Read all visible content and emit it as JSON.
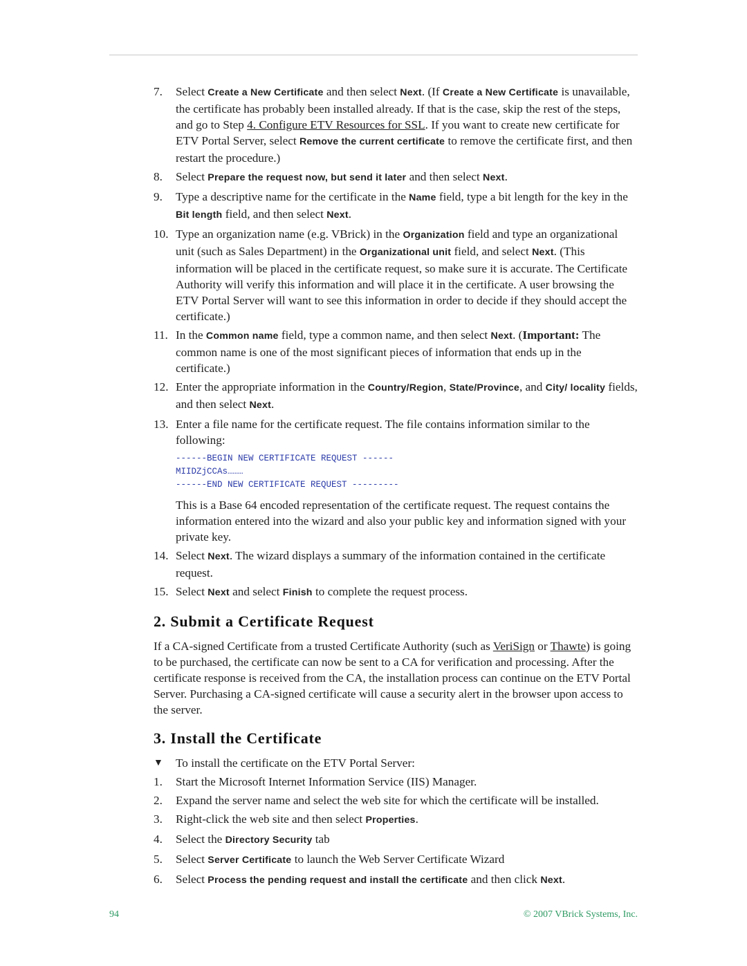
{
  "steps_a": [
    {
      "num": "7.",
      "parts": [
        {
          "t": "Select "
        },
        {
          "b": "Create a New Certificate"
        },
        {
          "t": " and then select "
        },
        {
          "b": "Next"
        },
        {
          "t": ". (If "
        },
        {
          "b": "Create a New Certificate"
        },
        {
          "t": " is unavailable, the certificate has probably been installed already. If that is the case, skip the rest of the steps, and go to Step "
        },
        {
          "link": "4. Configure ETV Resources for SSL"
        },
        {
          "t": ". If you want to create new certificate for ETV Portal Server, select "
        },
        {
          "b": "Remove the current certificate"
        },
        {
          "t": " to remove the certificate first, and then restart the procedure.)"
        }
      ]
    },
    {
      "num": "8.",
      "parts": [
        {
          "t": "Select "
        },
        {
          "b": "Prepare the request now, but send it later"
        },
        {
          "t": " and then select "
        },
        {
          "b": "Next"
        },
        {
          "t": "."
        }
      ]
    },
    {
      "num": "9.",
      "parts": [
        {
          "t": "Type a descriptive name for the certificate in the "
        },
        {
          "b": "Name"
        },
        {
          "t": " field, type a bit length for the key in the "
        },
        {
          "b": "Bit length"
        },
        {
          "t": " field, and then select "
        },
        {
          "b": "Next"
        },
        {
          "t": "."
        }
      ]
    },
    {
      "num": "10.",
      "parts": [
        {
          "t": "Type an organization name (e.g. VBrick) in the "
        },
        {
          "b": "Organization"
        },
        {
          "t": " field and type an organizational unit (such as Sales Department) in the "
        },
        {
          "b": "Organizational unit"
        },
        {
          "t": " field, and select "
        },
        {
          "b": "Next"
        },
        {
          "t": ". (This information will be placed in the certificate request, so make sure it is accurate. The Certificate Authority will verify this information and will place it in the certificate. A user browsing the ETV Portal Server will want to see this information in order to decide if they should accept the certificate.)"
        }
      ]
    },
    {
      "num": "11.",
      "parts": [
        {
          "t": "In the "
        },
        {
          "b": "Common name"
        },
        {
          "t": " field, type a common name, and then select "
        },
        {
          "b": "Next"
        },
        {
          "t": ". ("
        },
        {
          "sb": "Important:"
        },
        {
          "t": " The common name is one of the most significant pieces of information that ends up in the certificate.)"
        }
      ]
    },
    {
      "num": "12.",
      "parts": [
        {
          "t": "Enter the appropriate information in the "
        },
        {
          "b": "Country/Region"
        },
        {
          "t": ", "
        },
        {
          "b": "State/Province"
        },
        {
          "t": ", and "
        },
        {
          "b": "City/ locality"
        },
        {
          "t": " fields, and then select "
        },
        {
          "b": "Next"
        },
        {
          "t": "."
        }
      ]
    },
    {
      "num": "13.",
      "parts": [
        {
          "t": "Enter a file name for the certificate request. The file contains information similar to the following:"
        }
      ]
    }
  ],
  "code_lines": [
    "------BEGIN NEW CERTIFICATE REQUEST ------",
    "MIIDZjCCAs………",
    "------END NEW CERTIFICATE REQUEST ---------"
  ],
  "after_code": "This is a Base 64 encoded representation of the certificate request. The request contains the information entered into the wizard and also your public key and information signed with your private key.",
  "steps_b": [
    {
      "num": "14.",
      "parts": [
        {
          "t": "Select "
        },
        {
          "b": "Next"
        },
        {
          "t": ". The wizard displays a summary of the information contained in the certificate request."
        }
      ]
    },
    {
      "num": "15.",
      "parts": [
        {
          "t": "Select "
        },
        {
          "b": "Next"
        },
        {
          "t": " and select "
        },
        {
          "b": "Finish"
        },
        {
          "t": " to complete the request process."
        }
      ]
    }
  ],
  "section2": {
    "heading": "2. Submit a Certificate Request",
    "parts": [
      {
        "t": "If a CA-signed Certificate from a trusted Certificate Authority (such as "
      },
      {
        "link": "VeriSign"
      },
      {
        "t": " or "
      },
      {
        "link": "Thawte"
      },
      {
        "t": ") is going to be purchased, the certificate can now be sent to a CA for verification and processing. After the certificate response is received from the CA, the installation process can continue on the ETV Portal Server. Purchasing a CA-signed certificate will cause a security alert in the browser upon access to the server."
      }
    ]
  },
  "section3": {
    "heading": "3. Install the Certificate",
    "procedure_marker": "▼",
    "procedure_intro": "To install the certificate on the ETV Portal Server:",
    "steps": [
      {
        "num": "1.",
        "parts": [
          {
            "t": "Start the Microsoft Internet Information Service (IIS) Manager."
          }
        ]
      },
      {
        "num": "2.",
        "parts": [
          {
            "t": "Expand the server name and select the web site for which the certificate will be installed."
          }
        ]
      },
      {
        "num": "3.",
        "parts": [
          {
            "t": "Right-click the web site and then select "
          },
          {
            "b": "Properties"
          },
          {
            "t": "."
          }
        ]
      },
      {
        "num": "4.",
        "parts": [
          {
            "t": "Select the "
          },
          {
            "b": "Directory Security"
          },
          {
            "t": " tab"
          }
        ]
      },
      {
        "num": "5.",
        "parts": [
          {
            "t": "Select "
          },
          {
            "b": "Server Certificate"
          },
          {
            "t": " to launch the Web Server Certificate Wizard"
          }
        ]
      },
      {
        "num": "6.",
        "parts": [
          {
            "t": "Select "
          },
          {
            "b": "Process the pending request and install the certificate"
          },
          {
            "t": " and then click "
          },
          {
            "b": "Next"
          },
          {
            "t": "."
          }
        ]
      }
    ]
  },
  "footer": {
    "page_number": "94",
    "copyright": "© 2007 VBrick Systems, Inc."
  }
}
